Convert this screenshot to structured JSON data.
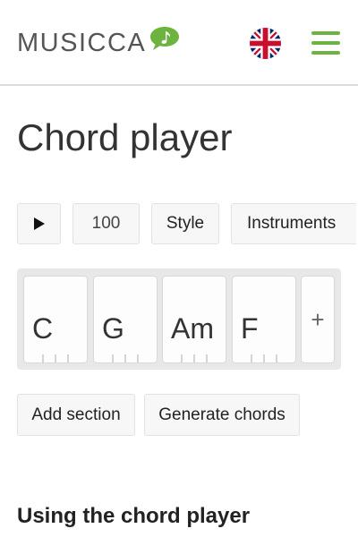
{
  "header": {
    "logo_text": "MUSICCA",
    "logo_icon": "music-note-speech-bubble",
    "language_flag": "uk-flag-icon",
    "menu_icon": "hamburger-menu-icon",
    "accent_color": "#6db33f"
  },
  "page": {
    "title": "Chord player"
  },
  "toolbar": {
    "play_icon": "play-icon",
    "tempo": "100",
    "style_label": "Style",
    "instruments_label": "Instruments"
  },
  "chords": [
    {
      "name": "C"
    },
    {
      "name": "G"
    },
    {
      "name": "Am"
    },
    {
      "name": "F"
    }
  ],
  "add_chord_label": "+",
  "actions": {
    "add_section_label": "Add section",
    "generate_chords_label": "Generate chords"
  },
  "content": {
    "subheading": "Using the chord player"
  }
}
